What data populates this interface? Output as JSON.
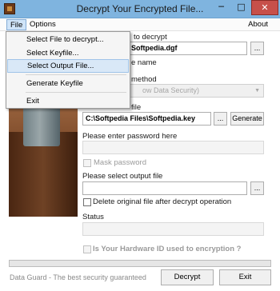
{
  "window": {
    "title": "Decrypt Your Encrypted File...",
    "min": "─",
    "max": "□",
    "close": "✕"
  },
  "menubar": {
    "file": "File",
    "options": "Options",
    "about": "About"
  },
  "file_menu": {
    "items": [
      "Select File to decrypt...",
      "Select Keyfile...",
      "Select Output File...",
      "Generate Keyfile",
      "Exit"
    ],
    "highlighted_index": 2
  },
  "form": {
    "file_label_partial": "to decrypt",
    "file_value": "Softpedia.dgf",
    "name_label_partial": "e name",
    "method_label_partial": "method",
    "method_value_partial": "ow Data Security)",
    "keyfile_label_partial": "file",
    "keyfile_value": "C:\\Softpedia Files\\Softpedia.key",
    "browse": "...",
    "generate": "Generate",
    "password_label": "Please enter password here",
    "password_value": "",
    "mask_password": "Mask password",
    "output_label": "Please select output file",
    "output_value": "",
    "delete_original": "Delete original file after decrypt operation",
    "status_label": "Status",
    "status_value": "",
    "hardware_id": "Is Your Hardware ID used to encryption ?"
  },
  "footer": {
    "note": "Data Guard - The best security guaranteed",
    "decrypt": "Decrypt",
    "exit": "Exit"
  },
  "progress_percent": 0
}
